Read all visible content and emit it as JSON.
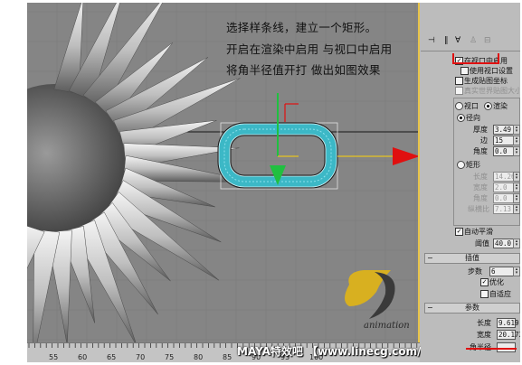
{
  "instructions": {
    "line1": "选择样条线，建立一个矩形。",
    "line2": "开启在渲染中启用  与视口中启用",
    "line3": "将角半径值开打    做出如图效果"
  },
  "ruler": {
    "ticks": [
      "55",
      "60",
      "65",
      "70",
      "75",
      "80",
      "85",
      "90",
      "95",
      "100"
    ]
  },
  "footer": {
    "text": "MAYA特效吧 【www.linecg.com/tieba/1745】"
  },
  "logo": {
    "text": "animation"
  },
  "panel": {
    "render": {
      "enable_viewport": "在视口中启用",
      "use_viewport_settings": "使用视口设置",
      "gen_mapping": "生成贴图坐标",
      "real_world": "真实世界贴图大小",
      "viewport_label": "视口",
      "render_label": "渲染",
      "radial_label": "径向",
      "thickness_label": "厚度",
      "thickness_value": "3.49",
      "sides_label": "边",
      "sides_value": "15",
      "angle_label": "角度",
      "angle_value": "0.0",
      "rect_label": "矩形",
      "length_label": "长度",
      "length_value": "14.261",
      "width_label": "宽度",
      "width_value": "2.0",
      "angle2_label": "角度",
      "angle2_value": "0.0",
      "aspect_label": "纵横比",
      "aspect_value": "7.13",
      "auto_smooth": "自动平滑",
      "threshold_label": "阈值",
      "threshold_value": "40.0"
    },
    "interpolation": {
      "title": "插值",
      "steps_label": "步数",
      "steps_value": "6",
      "optimize": "优化",
      "adaptive": "自适应"
    },
    "parameters": {
      "title": "参数",
      "length_label": "长度",
      "length_value": "9.619",
      "width_label": "宽度",
      "width_value": "20.172",
      "corner_label": "角半径"
    }
  },
  "colors": {
    "viewport_bg": "#858585",
    "selection_arrow": "#e01010",
    "y_axis": "#20c040",
    "x_axis": "#e8c420",
    "tube": "#38b8c8",
    "highlight": "#e01010"
  }
}
